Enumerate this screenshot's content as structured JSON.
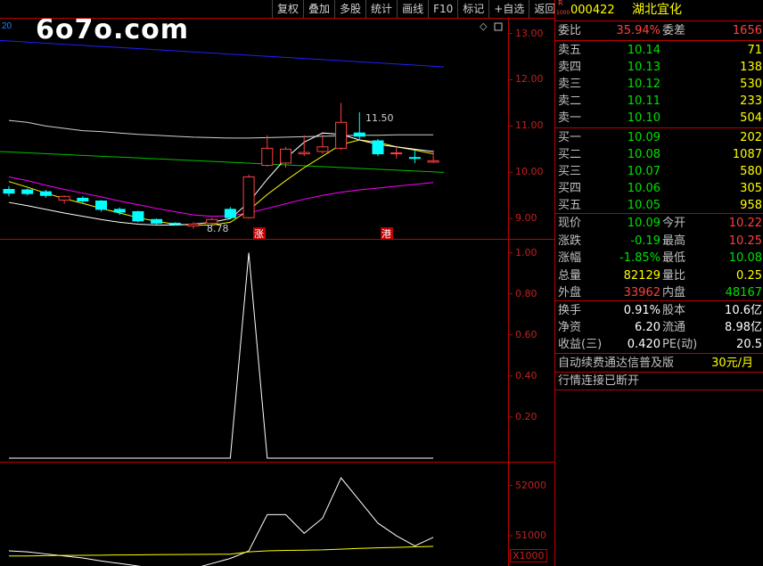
{
  "toolbar": [
    "复权",
    "叠加",
    "多股",
    "统计",
    "画线",
    "F10",
    "标记",
    "+自选",
    "返回"
  ],
  "logo": "6o7o.com",
  "top_left_number": "20",
  "stock": {
    "code": "000422",
    "name": "湖北宜化",
    "badge_top": "R",
    "badge_bottom": "1000"
  },
  "webi": {
    "l1": "委比",
    "v1": "35.94%",
    "l2": "委差",
    "v2": "1656"
  },
  "sell": [
    {
      "label": "卖五",
      "price": "10.14",
      "vol": "71"
    },
    {
      "label": "卖四",
      "price": "10.13",
      "vol": "138"
    },
    {
      "label": "卖三",
      "price": "10.12",
      "vol": "530"
    },
    {
      "label": "卖二",
      "price": "10.11",
      "vol": "233"
    },
    {
      "label": "卖一",
      "price": "10.10",
      "vol": "504"
    }
  ],
  "buy": [
    {
      "label": "买一",
      "price": "10.09",
      "vol": "202"
    },
    {
      "label": "买二",
      "price": "10.08",
      "vol": "1087"
    },
    {
      "label": "买三",
      "price": "10.07",
      "vol": "580"
    },
    {
      "label": "买四",
      "price": "10.06",
      "vol": "305"
    },
    {
      "label": "买五",
      "price": "10.05",
      "vol": "958"
    }
  ],
  "quote": [
    {
      "l1": "现价",
      "v1": "10.09",
      "l2": "今开",
      "v2": "10.22"
    },
    {
      "l1": "涨跌",
      "v1": "-0.19",
      "l2": "最高",
      "v2": "10.25"
    },
    {
      "l1": "涨幅",
      "v1": "-1.85%",
      "l2": "最低",
      "v2": "10.08"
    },
    {
      "l1": "总量",
      "v1": "82129",
      "l2": "量比",
      "v2": "0.25"
    },
    {
      "l1": "外盘",
      "v1": "33962",
      "l2": "内盘",
      "v2": "48167"
    }
  ],
  "fin": [
    {
      "l1": "换手",
      "v1": "0.91%",
      "l2": "股本",
      "v2": "10.6亿"
    },
    {
      "l1": "净资",
      "v1": "6.20",
      "l2": "流通",
      "v2": "8.98亿"
    },
    {
      "l1": "收益(三)",
      "v1": "0.420",
      "l2": "PE(动)",
      "v2": "20.5"
    }
  ],
  "ad": {
    "text": "自动续费通达信普及版",
    "price": "30元/月"
  },
  "status": "行情连接已断开",
  "axis1": [
    "13.00",
    "12.00",
    "11.00",
    "10.00",
    "9.00"
  ],
  "axis2": [
    "1.00",
    "0.80",
    "0.60",
    "0.40",
    "0.20"
  ],
  "axis3": [
    "52000",
    "51000"
  ],
  "axis3_unit": "X1000",
  "annot": {
    "high": "11.50",
    "low": "8.78",
    "mark1": "涨",
    "mark2": "港"
  },
  "colors": {
    "up": "#ff4040",
    "down": "#00ffff",
    "frame": "#c00000",
    "ma_blue": "#2020ff",
    "ma_green": "#00c000",
    "ma_magenta": "#ff00ff",
    "ma_yellow": "#ffff00"
  },
  "chart_data": [
    {
      "type": "candlestick",
      "title": "",
      "ylim": [
        8.6,
        13.3
      ],
      "candles": [
        {
          "o": 9.63,
          "c": 9.55,
          "h": 9.7,
          "l": 9.48
        },
        {
          "o": 9.62,
          "c": 9.54,
          "h": 9.65,
          "l": 9.5
        },
        {
          "o": 9.58,
          "c": 9.5,
          "h": 9.62,
          "l": 9.45
        },
        {
          "o": 9.4,
          "c": 9.48,
          "h": 9.5,
          "l": 9.32
        },
        {
          "o": 9.44,
          "c": 9.38,
          "h": 9.48,
          "l": 9.33
        },
        {
          "o": 9.38,
          "c": 9.2,
          "h": 9.4,
          "l": 9.15
        },
        {
          "o": 9.2,
          "c": 9.14,
          "h": 9.24,
          "l": 9.08
        },
        {
          "o": 9.15,
          "c": 8.95,
          "h": 9.17,
          "l": 8.92
        },
        {
          "o": 8.98,
          "c": 8.9,
          "h": 9.0,
          "l": 8.86
        },
        {
          "o": 8.9,
          "c": 8.88,
          "h": 8.92,
          "l": 8.85
        },
        {
          "o": 8.84,
          "c": 8.88,
          "h": 8.92,
          "l": 8.78
        },
        {
          "o": 8.9,
          "c": 8.98,
          "h": 9.02,
          "l": 8.85
        },
        {
          "o": 9.2,
          "c": 9.02,
          "h": 9.25,
          "l": 8.98
        },
        {
          "o": 9.02,
          "c": 9.9,
          "h": 9.95,
          "l": 9.0
        },
        {
          "o": 10.15,
          "c": 10.52,
          "h": 10.8,
          "l": 10.12
        },
        {
          "o": 10.2,
          "c": 10.5,
          "h": 10.55,
          "l": 10.1
        },
        {
          "o": 10.4,
          "c": 10.43,
          "h": 10.8,
          "l": 10.35
        },
        {
          "o": 10.45,
          "c": 10.55,
          "h": 10.82,
          "l": 10.4
        },
        {
          "o": 10.52,
          "c": 11.08,
          "h": 11.5,
          "l": 10.48
        },
        {
          "o": 10.85,
          "c": 10.78,
          "h": 11.3,
          "l": 10.72
        },
        {
          "o": 10.68,
          "c": 10.4,
          "h": 10.72,
          "l": 10.35
        },
        {
          "o": 10.4,
          "c": 10.42,
          "h": 10.55,
          "l": 10.3
        },
        {
          "o": 10.32,
          "c": 10.3,
          "h": 10.48,
          "l": 10.2
        },
        {
          "o": 10.22,
          "c": 10.25,
          "h": 10.48,
          "l": 10.2
        }
      ],
      "ma_lines": {
        "blue": [
          12.85,
          12.28
        ],
        "green": [
          10.45,
          10.0
        ],
        "white": [
          11.12,
          11.08,
          11.0,
          10.95,
          10.9,
          10.88,
          10.85,
          10.82,
          10.8,
          10.78,
          10.76,
          10.75,
          10.74,
          10.74,
          10.75,
          10.76,
          10.77,
          10.78,
          10.79,
          10.8,
          10.8,
          10.81,
          10.81,
          10.81
        ],
        "magenta": [
          9.9,
          9.82,
          9.72,
          9.63,
          9.55,
          9.47,
          9.38,
          9.3,
          9.22,
          9.15,
          9.08,
          9.05,
          9.06,
          9.12,
          9.22,
          9.32,
          9.42,
          9.5,
          9.57,
          9.62,
          9.66,
          9.7,
          9.74,
          9.78
        ],
        "yellow": [
          9.8,
          9.68,
          9.55,
          9.43,
          9.33,
          9.22,
          9.12,
          9.02,
          8.94,
          8.88,
          8.86,
          8.86,
          8.92,
          9.18,
          9.52,
          9.82,
          10.1,
          10.35,
          10.6,
          10.7,
          10.65,
          10.55,
          10.48,
          10.4
        ],
        "white2": [
          9.35,
          9.28,
          9.2,
          9.12,
          9.05,
          8.98,
          8.92,
          8.88,
          8.86,
          8.86,
          8.88,
          8.92,
          9.0,
          9.35,
          9.85,
          10.3,
          10.65,
          10.85,
          10.82,
          10.7,
          10.6,
          10.55,
          10.5,
          10.45
        ]
      }
    },
    {
      "type": "line",
      "ylim": [
        0,
        1.05
      ],
      "values": [
        0,
        0,
        0,
        0,
        0,
        0,
        0,
        0,
        0,
        0,
        0,
        0,
        0,
        1,
        0,
        0,
        0,
        0,
        0,
        0,
        0,
        0,
        0,
        0
      ]
    },
    {
      "type": "line",
      "ylim": [
        50400,
        52400
      ],
      "series": [
        {
          "values": [
            50700,
            50680,
            50640,
            50600,
            50560,
            50500,
            50450,
            50400,
            50350,
            50320,
            50350,
            50450,
            50550,
            50700,
            51420,
            51420,
            51050,
            51350,
            52150,
            51700,
            51250,
            51000,
            50800,
            50970
          ]
        },
        {
          "values": [
            50600,
            50600,
            50605,
            50610,
            50612,
            50615,
            50620,
            50622,
            50625,
            50628,
            50630,
            50632,
            50635,
            50680,
            50700,
            50710,
            50715,
            50720,
            50735,
            50750,
            50760,
            50770,
            50780,
            50790
          ]
        }
      ]
    }
  ]
}
